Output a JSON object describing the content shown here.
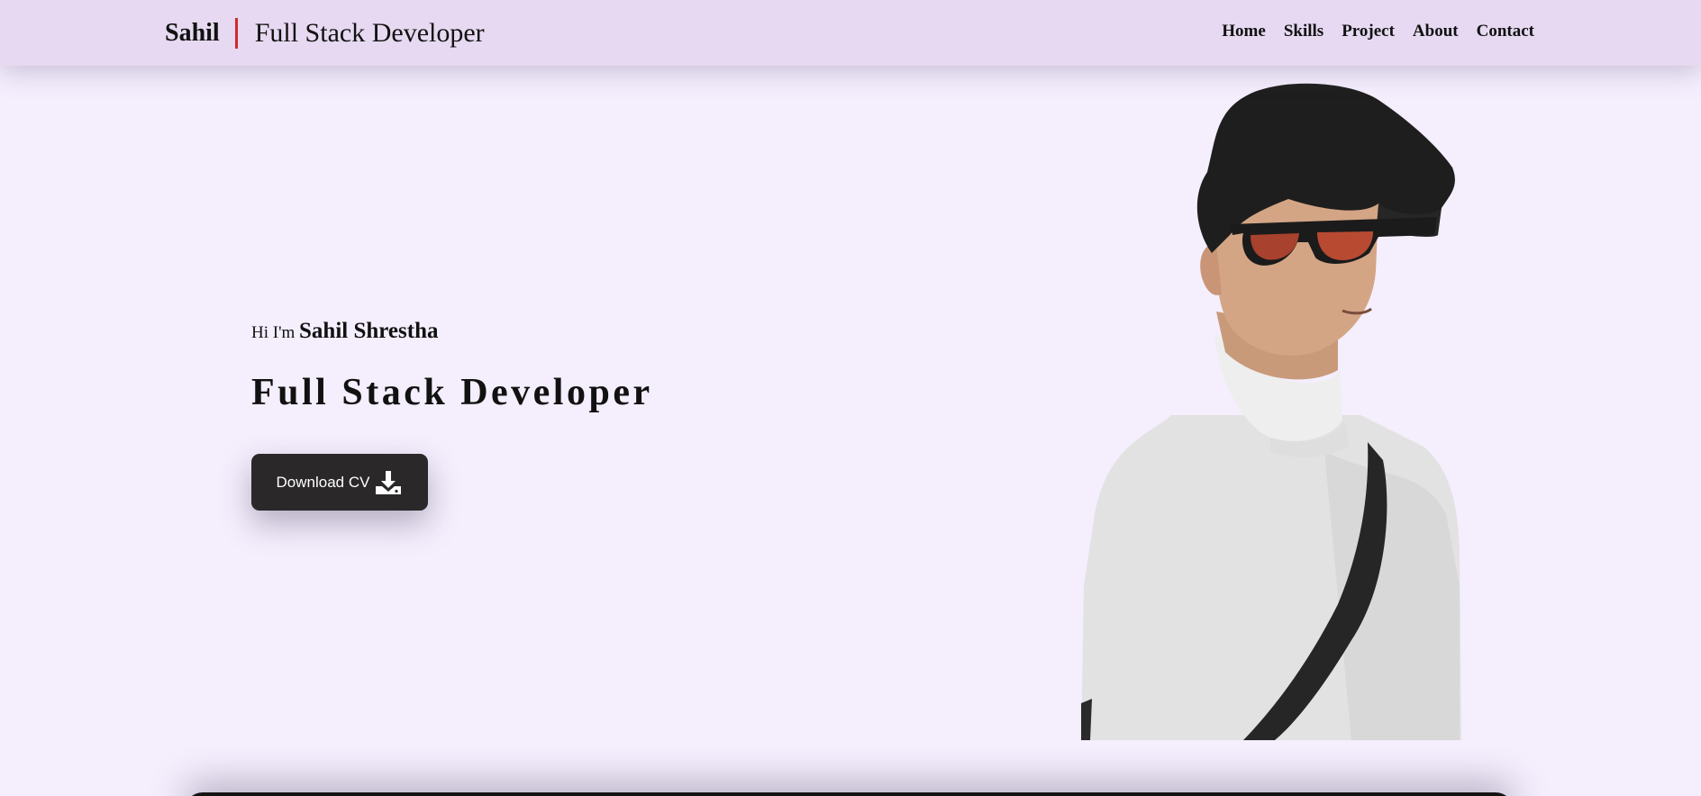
{
  "header": {
    "brand_name": "Sahil",
    "brand_role": "Full Stack Developer",
    "nav": [
      "Home",
      "Skills",
      "Project",
      "About",
      "Contact"
    ]
  },
  "hero": {
    "greeting_prefix": "Hi I'm",
    "name": "Sahil Shrestha",
    "title": "Full Stack Developer",
    "cta_label": "Download CV",
    "cta_icon": "download-icon"
  },
  "colors": {
    "page_bg": "#f4eefd",
    "navbar_bg": "#e6d9f1",
    "brand_divider": "#d12a2a",
    "button_bg": "#2a2829"
  }
}
